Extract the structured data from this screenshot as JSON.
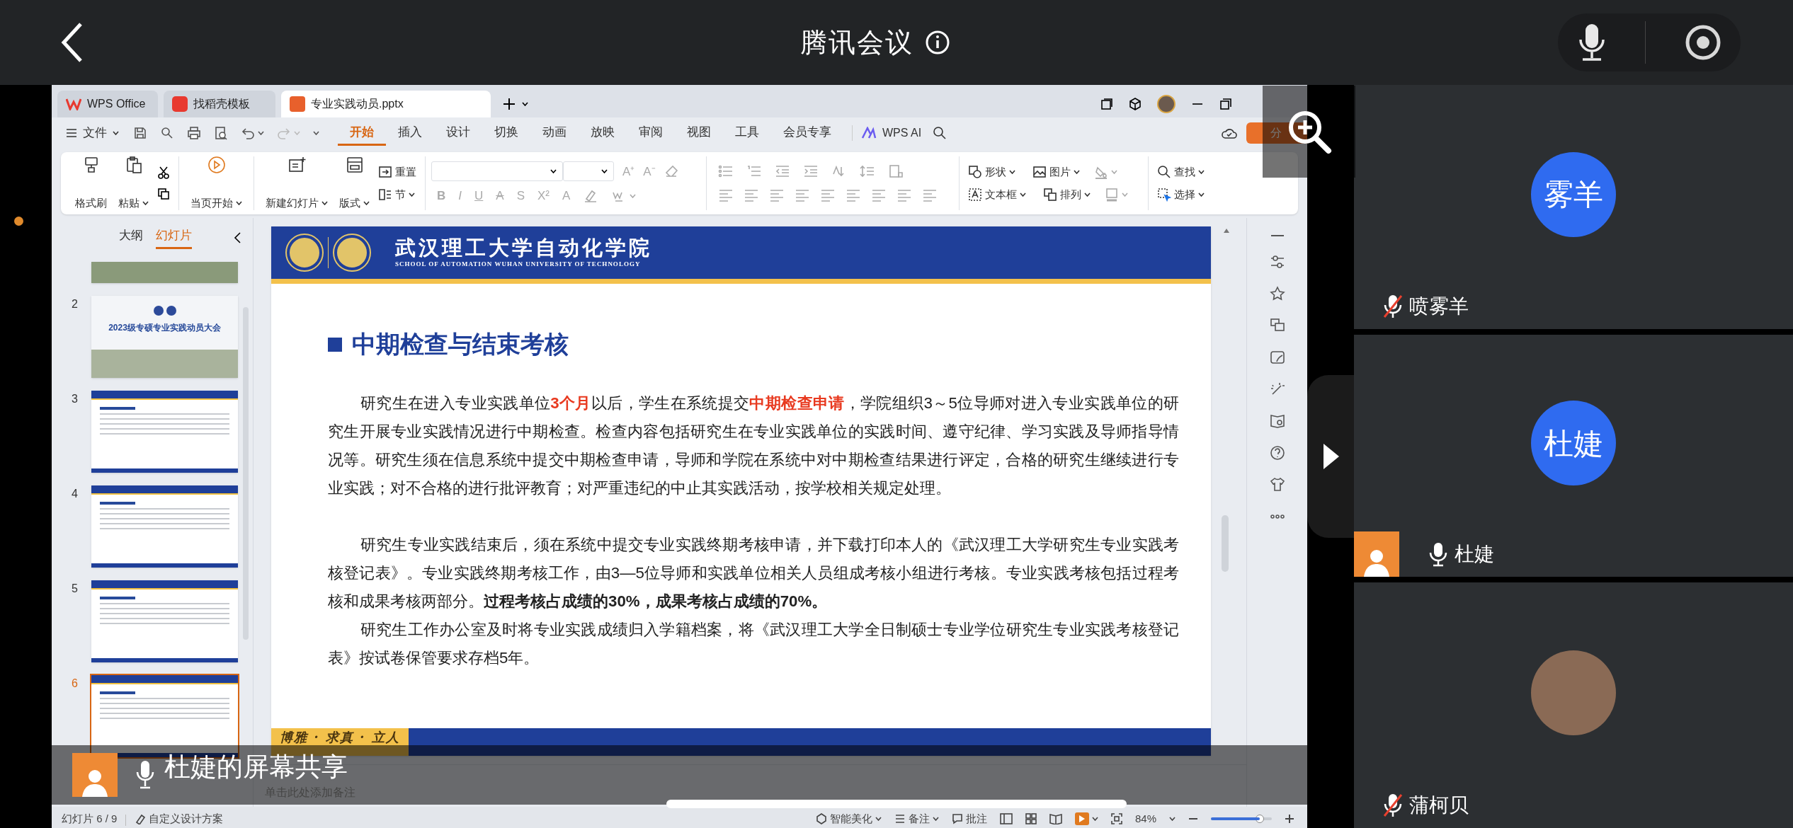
{
  "meeting": {
    "title": "腾讯会议"
  },
  "wps": {
    "tabs": [
      {
        "label": "WPS Office",
        "kind": "home",
        "selected": false
      },
      {
        "label": "找稻壳模板",
        "kind": "template",
        "selected": false
      },
      {
        "label": "专业实践动员.pptx",
        "kind": "presentation",
        "selected": true
      }
    ],
    "share_button": "分",
    "menu": {
      "file": "文件",
      "ai": "WPS AI",
      "tabs": [
        {
          "label": "开始",
          "selected": true
        },
        {
          "label": "插入",
          "selected": false
        },
        {
          "label": "设计",
          "selected": false
        },
        {
          "label": "切换",
          "selected": false
        },
        {
          "label": "动画",
          "selected": false
        },
        {
          "label": "放映",
          "selected": false
        },
        {
          "label": "审阅",
          "selected": false
        },
        {
          "label": "视图",
          "selected": false
        },
        {
          "label": "工具",
          "selected": false
        },
        {
          "label": "会员专享",
          "selected": false
        }
      ]
    },
    "ribbon": {
      "format_painter": "格式刷",
      "paste": "粘贴",
      "play_from_current": "当页开始",
      "new_slide": "新建幻灯片",
      "layout": "版式",
      "reset": "重置",
      "section": "节",
      "grow_font": "A⁺",
      "shrink_font": "A⁻",
      "format_glyphs": [
        "B",
        "I",
        "U",
        "A",
        "S",
        "X²",
        "A"
      ],
      "shape": "形状",
      "picture": "图片",
      "text_box": "文本框",
      "arrange": "排列",
      "find": "查找",
      "select": "选择"
    },
    "pane_tabs": [
      {
        "label": "大纲",
        "selected": false
      },
      {
        "label": "幻灯片",
        "selected": true
      }
    ],
    "thumbnails": [
      {
        "kind": "photo",
        "selected": false
      },
      {
        "number": "2",
        "kind": "cover",
        "title": "2023级专硕专业实践动员大会",
        "selected": false
      },
      {
        "number": "3",
        "kind": "content",
        "selected": false
      },
      {
        "number": "4",
        "kind": "content",
        "selected": false
      },
      {
        "number": "5",
        "kind": "content",
        "selected": false
      },
      {
        "number": "6",
        "kind": "content",
        "selected": true
      }
    ],
    "slide": {
      "school": "武汉理工大学自动化学院",
      "school_en": "SCHOOL OF AUTOMATION WUHAN UNIVERSITY OF TECHNOLOGY",
      "title": "中期检查与结束考核",
      "motto": "博雅 · 求真 · 立人",
      "sections": [
        {
          "paragraphs": [
            {
              "runs": [
                {
                  "kind": "plain",
                  "text": "研究生在进入专业实践单位"
                },
                {
                  "kind": "highlight",
                  "text": "3个月"
                },
                {
                  "kind": "plain",
                  "text": "以后，学生在系统提交"
                },
                {
                  "kind": "highlight",
                  "text": "中期检查申请"
                },
                {
                  "kind": "plain",
                  "text": "，学院组织3～5位导师对进入专业实践单位的研究生开展专业实践情况进行中期检查。检查内容包括研究生在专业实践单位的实践时间、遵守纪律、学习实践及导师指导情况等。研究生须在信息系统中提交中期检查申请，导师和学院在系统中对中期检查结果进行评定，合格的研究生继续进行专业实践；对不合格的进行批评教育；对严重违纪的中止其实践活动，按学校相关规定处理。"
                }
              ]
            }
          ]
        },
        {
          "paragraphs": [
            {
              "runs": [
                {
                  "kind": "plain",
                  "text": "研究生专业实践结束后，须在系统中提交专业实践终期考核申请，并下载打印本人的《武汉理工大学研究生专业实践考核登记表》。专业实践终期考核工作，由3—5位导师和实践单位相关人员组成考核小组进行考核。专业实践考核包括过程考核和成果考核两部分。"
                },
                {
                  "kind": "bold",
                  "text": "过程考核占成绩的30%，成果考核占成绩的70%。"
                }
              ]
            },
            {
              "runs": [
                {
                  "kind": "plain",
                  "text": "研究生工作办公室及时将专业实践成绩归入学籍档案，将《武汉理工大学全日制硕士专业学位研究生专业实践考核登记表》按试卷保管要求存档5年。"
                }
              ]
            }
          ]
        }
      ]
    },
    "notes_placeholder": "单击此处添加备注",
    "status": {
      "slide_counter": "幻灯片 6 / 9",
      "design": "自定义设计方案",
      "beautify": "智能美化",
      "notes": "备注",
      "comments": "批注",
      "zoom": "84%",
      "zoom_slider": {
        "level": 0.8
      }
    }
  },
  "share_banner": {
    "label": "杜婕的屏幕共享"
  },
  "participants": [
    {
      "kind": "initials",
      "avatar_text": "雾羊",
      "name": "喷雾羊",
      "muted": true,
      "sharing": false
    },
    {
      "kind": "initials",
      "avatar_text": "杜婕",
      "name": "杜婕",
      "muted": false,
      "sharing": true
    },
    {
      "kind": "photo",
      "name": "蒲柯贝",
      "muted": true,
      "sharing": false
    }
  ]
}
